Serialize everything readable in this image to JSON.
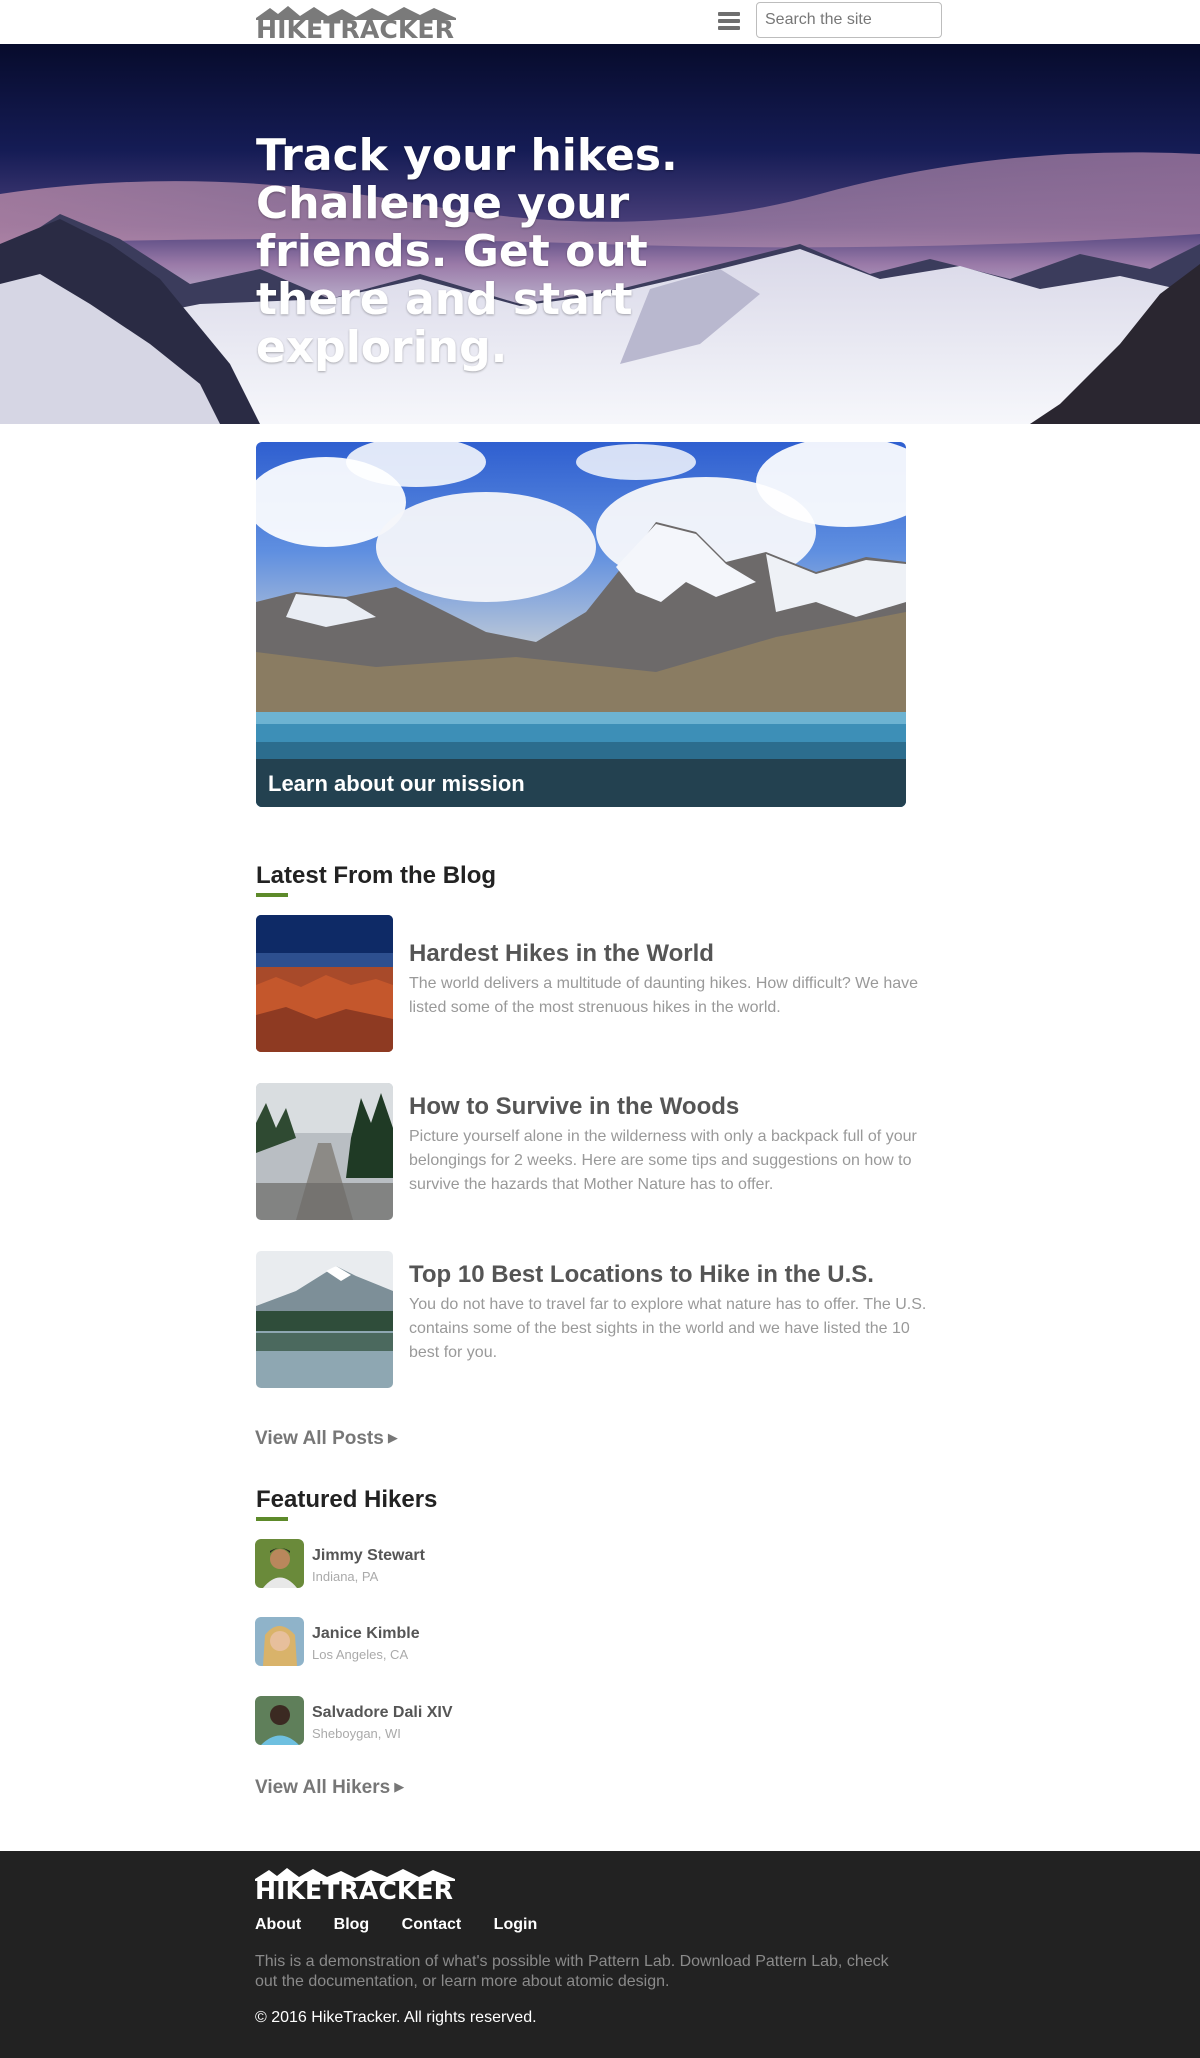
{
  "header": {
    "logo_text": "HIKETRACKER",
    "menu_icon": "hamburger-icon",
    "search_placeholder": "Search the site"
  },
  "hero": {
    "title": "Track your hikes. Challenge your friends. Get out there and start exploring."
  },
  "mission": {
    "caption": "Learn about our mission"
  },
  "blog": {
    "heading": "Latest From the Blog",
    "posts": [
      {
        "title": "Hardest Hikes in the World",
        "excerpt": "The world delivers a multitude of daunting hikes. How difficult? We have listed some of the most strenuous hikes in the world."
      },
      {
        "title": "How to Survive in the Woods",
        "excerpt": "Picture yourself alone in the wilderness with only a backpack full of your belongings for 2 weeks. Here are some tips and suggestions on how to survive the hazards that Mother Nature has to offer."
      },
      {
        "title": "Top 10 Best Locations to Hike in the U.S.",
        "excerpt": "You do not have to travel far to explore what nature has to offer. The U.S. contains some of the best sights in the world and we have listed the 10 best for you."
      }
    ],
    "view_all": "View All Posts"
  },
  "hikers": {
    "heading": "Featured Hikers",
    "items": [
      {
        "name": "Jimmy Stewart",
        "location": "Indiana, PA"
      },
      {
        "name": "Janice Kimble",
        "location": "Los Angeles, CA"
      },
      {
        "name": "Salvadore Dali XIV",
        "location": "Sheboygan, WI"
      }
    ],
    "view_all": "View All Hikers"
  },
  "footer": {
    "logo_text": "HIKETRACKER",
    "nav": [
      "About",
      "Blog",
      "Contact",
      "Login"
    ],
    "description": "This is a demonstration of what's possible with Pattern Lab. Download Pattern Lab, check out the documentation, or learn more about atomic design.",
    "copyright": "© 2016 HikeTracker. All rights reserved."
  },
  "colors": {
    "accent": "#5d8a2a",
    "footer_bg": "#222222",
    "heading_gray": "#555555",
    "body_gray": "#999999"
  }
}
